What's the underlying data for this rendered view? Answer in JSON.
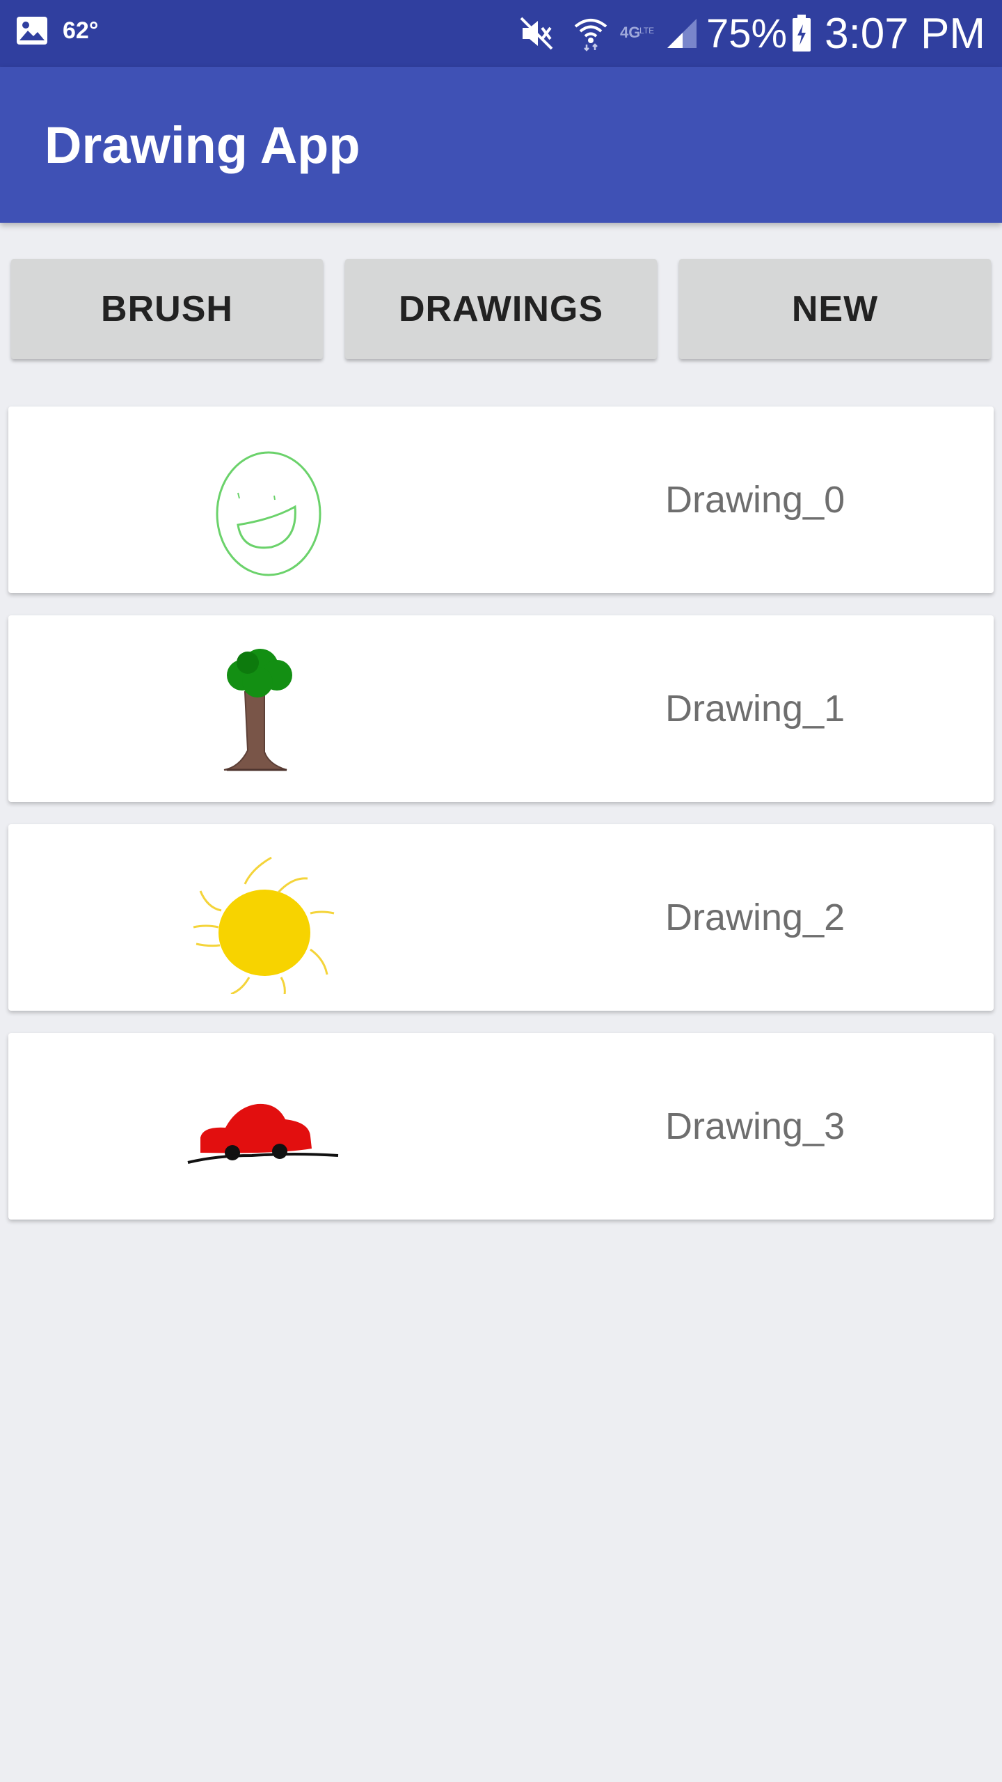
{
  "status_bar": {
    "temperature": "62°",
    "battery": "75%",
    "time": "3:07 PM",
    "icons": [
      "gallery-icon",
      "mute-icon",
      "wifi-icon",
      "4g-icon",
      "signal-icon",
      "battery-icon"
    ]
  },
  "app_bar": {
    "title": "Drawing App"
  },
  "toolbar": {
    "brush_label": "BRUSH",
    "drawings_label": "DRAWINGS",
    "new_label": "NEW"
  },
  "drawings": [
    {
      "name": "Drawing_0",
      "thumbnail": "smiley-face-drawing"
    },
    {
      "name": "Drawing_1",
      "thumbnail": "tree-drawing"
    },
    {
      "name": "Drawing_2",
      "thumbnail": "sun-drawing"
    },
    {
      "name": "Drawing_3",
      "thumbnail": "car-drawing"
    }
  ],
  "colors": {
    "status_bar": "#303f9f",
    "app_bar": "#3f51b5",
    "button": "#d6d7d7",
    "background": "#edeef2",
    "card": "#ffffff",
    "label_text": "#6e6e6e"
  }
}
